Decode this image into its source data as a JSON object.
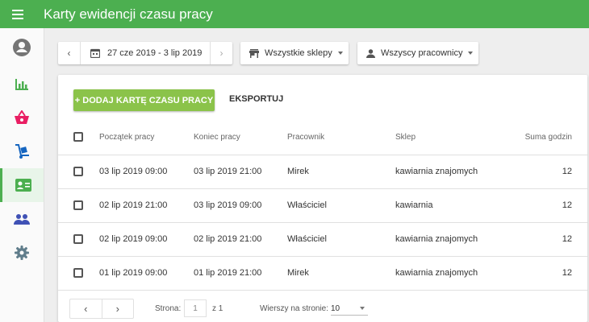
{
  "app": {
    "title": "Karty ewidencji czasu pracy"
  },
  "sidebar": {
    "items": [
      {
        "icon": "account-icon",
        "color": "#757575"
      },
      {
        "icon": "bar-chart-icon",
        "color": "#4caf50"
      },
      {
        "icon": "basket-icon",
        "color": "#e91e63"
      },
      {
        "icon": "hand-truck-icon",
        "color": "#1565c0"
      },
      {
        "icon": "id-card-icon",
        "color": "#4caf50",
        "active": true
      },
      {
        "icon": "people-icon",
        "color": "#3f51b5"
      },
      {
        "icon": "gear-icon",
        "color": "#607d8b"
      }
    ]
  },
  "toolbar": {
    "date_range": "27 cze 2019 - 3 lip 2019",
    "shops_label": "Wszystkie sklepy",
    "workers_label": "Wszyscy pracownicy"
  },
  "actions": {
    "add_label": "+ DODAJ KARTĘ CZASU PRACY",
    "export_label": "EKSPORTUJ"
  },
  "table": {
    "headers": {
      "start": "Początek pracy",
      "end": "Koniec pracy",
      "worker": "Pracownik",
      "shop": "Sklep",
      "hours": "Suma godzin"
    },
    "rows": [
      {
        "start": "03 lip 2019 09:00",
        "end": "03 lip 2019 21:00",
        "worker": "Mirek",
        "shop": "kawiarnia znajomych",
        "hours": "12"
      },
      {
        "start": "02 lip 2019 21:00",
        "end": "03 lip 2019 09:00",
        "worker": "Właściciel",
        "shop": "kawiarnia",
        "hours": "12"
      },
      {
        "start": "02 lip 2019 09:00",
        "end": "02 lip 2019 21:00",
        "worker": "Właściciel",
        "shop": "kawiarnia znajomych",
        "hours": "12"
      },
      {
        "start": "01 lip 2019 09:00",
        "end": "01 lip 2019 21:00",
        "worker": "Mirek",
        "shop": "kawiarnia znajomych",
        "hours": "12"
      }
    ]
  },
  "pagination": {
    "page_label": "Strona:",
    "page_value": "1",
    "of_label": "z 1",
    "rows_label": "Wierszy na stronie:",
    "rows_value": "10"
  },
  "colors": {
    "primary": "#4caf50",
    "add_button": "#8bc34a"
  }
}
